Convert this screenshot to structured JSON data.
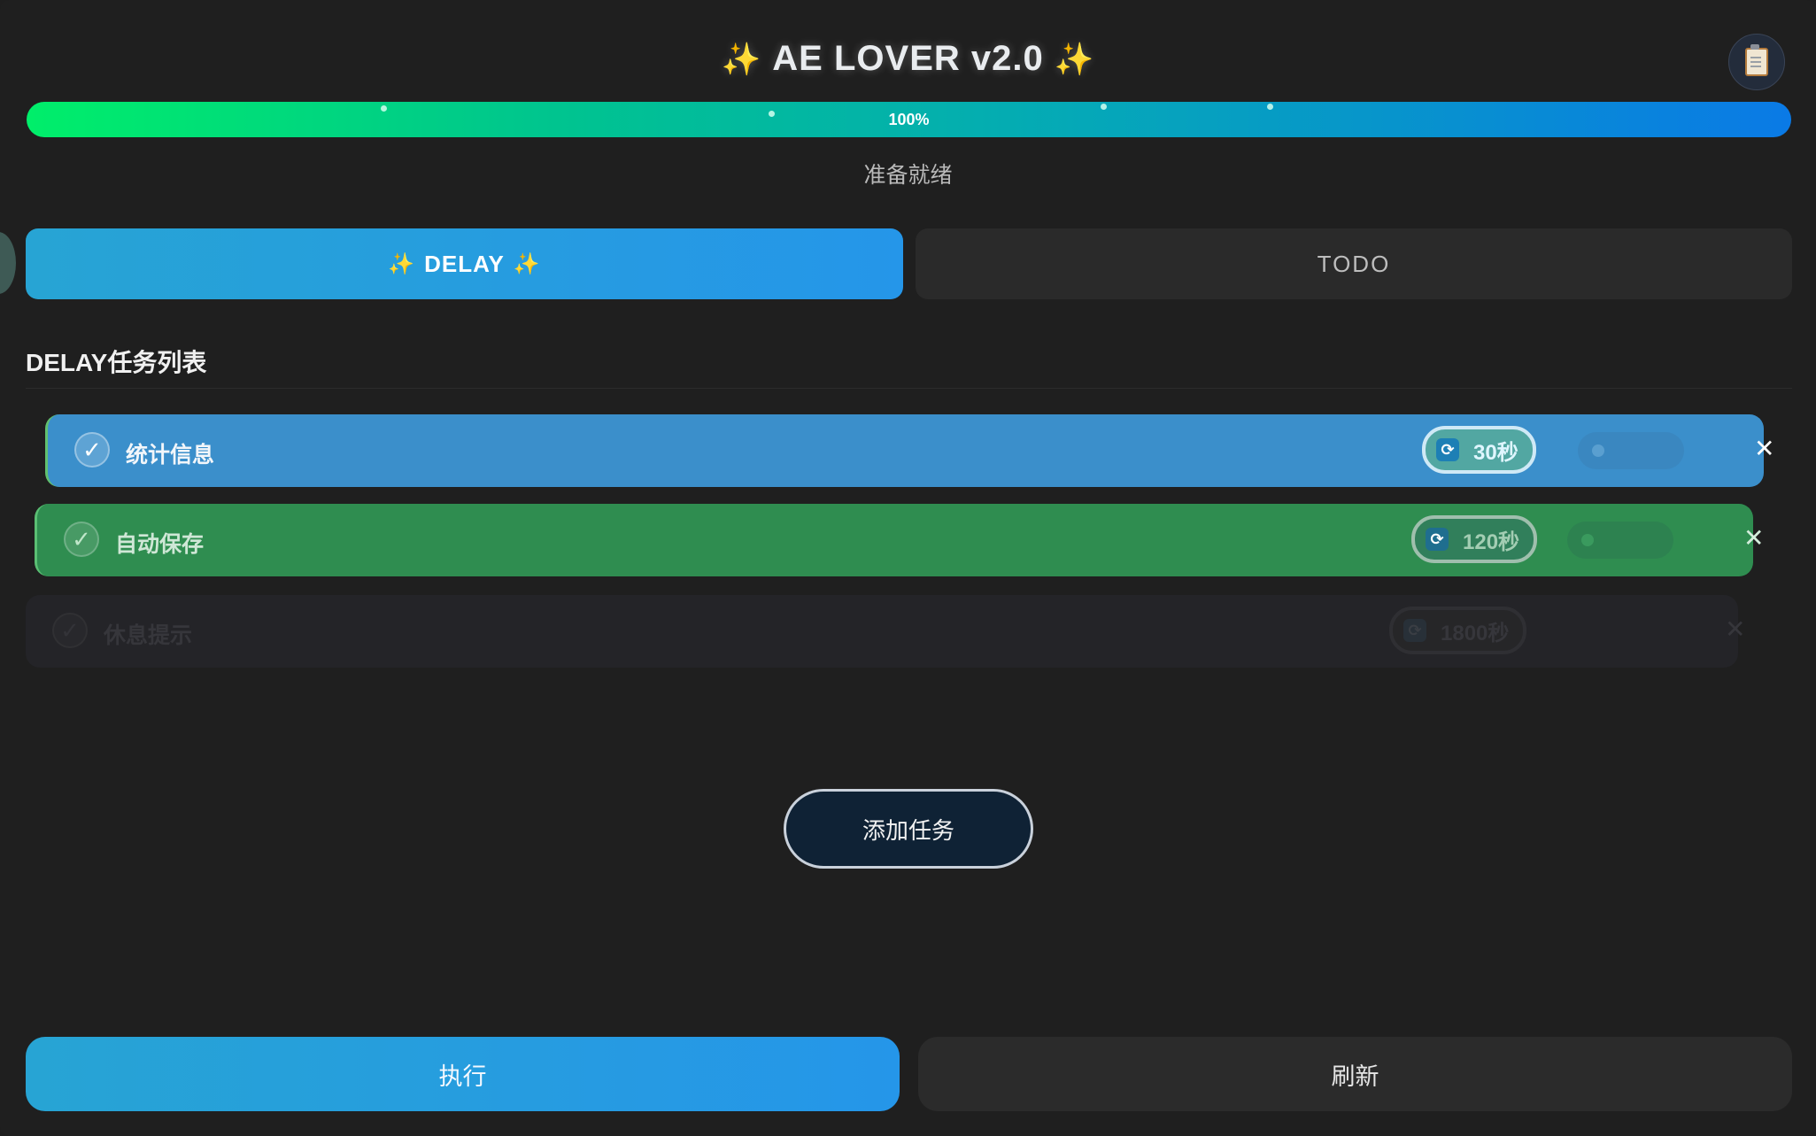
{
  "header": {
    "title": "AE LOVER v2.0",
    "sparkle": "✨",
    "clipboard_icon": "clipboard-icon"
  },
  "progress": {
    "value": 1.0,
    "label": "100%"
  },
  "status": "准备就绪",
  "tabs": [
    {
      "label": "DELAY",
      "active": true
    },
    {
      "label": "TODO",
      "active": false
    }
  ],
  "section": {
    "title": "DELAY任务列表"
  },
  "tasks": [
    {
      "label": "统计信息",
      "interval": "30秒",
      "checked": true
    },
    {
      "label": "自动保存",
      "interval": "120秒",
      "checked": true
    },
    {
      "label": "休息提示",
      "interval": "1800秒",
      "checked": false
    }
  ],
  "icons": {
    "check": "✓",
    "close": "✕",
    "refresh": "⟳"
  },
  "actions": {
    "add_task": "添加任务",
    "execute": "执行",
    "refresh": "刷新"
  },
  "colors": {
    "accent": "#2596e9",
    "task1": "#3b8fcb",
    "task2": "#2f8d50",
    "progress_start": "#00ee6a",
    "progress_end": "#0a7ae6"
  }
}
